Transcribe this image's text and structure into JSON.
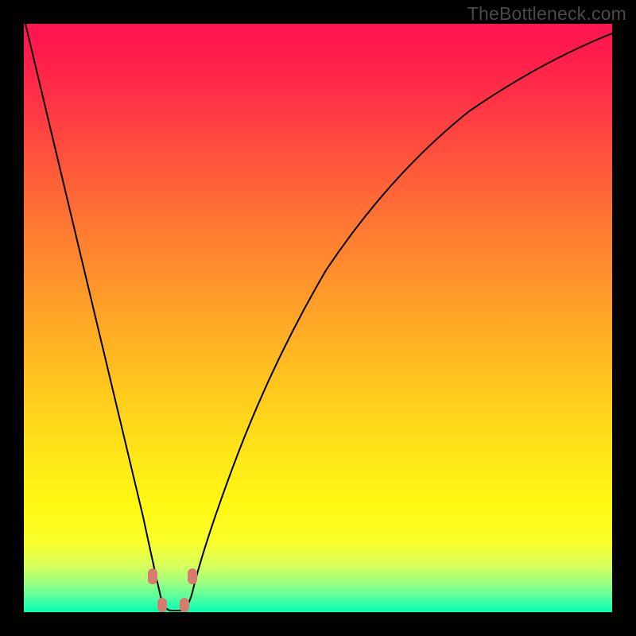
{
  "watermark": "TheBottleneck.com",
  "colors": {
    "page_bg": "#000000",
    "gradient_top": "#ff1450",
    "gradient_bottom": "#00ffb0",
    "curve_stroke": "#000000",
    "marker_fill": "#d87a6e"
  },
  "chart_data": {
    "type": "line",
    "title": "",
    "xlabel": "",
    "ylabel": "",
    "xlim": [
      0,
      100
    ],
    "ylim": [
      0,
      100
    ],
    "x": [
      0,
      2,
      4,
      6,
      8,
      10,
      12,
      14,
      16,
      18,
      20,
      22,
      23,
      24,
      25,
      26,
      27,
      28,
      30,
      35,
      40,
      45,
      50,
      55,
      60,
      65,
      70,
      75,
      80,
      85,
      90,
      95,
      100
    ],
    "y": [
      100,
      91,
      82,
      73,
      64,
      55,
      46,
      37,
      28,
      19,
      10,
      3,
      1,
      0,
      0,
      0,
      1,
      3,
      9,
      22,
      34,
      44,
      52,
      59,
      65,
      70,
      74,
      78,
      81,
      83.5,
      85.5,
      87,
      88
    ],
    "markers": [
      {
        "x": 22.0,
        "y": 6.0
      },
      {
        "x": 23.0,
        "y": 1.0
      },
      {
        "x": 26.5,
        "y": 1.0
      },
      {
        "x": 27.8,
        "y": 6.0
      }
    ],
    "notes": "V-shaped bottleneck curve; minimum near x≈25, y≈0. Gradient background encodes bottleneck severity (red=high, green=low). No numeric axes shown."
  }
}
